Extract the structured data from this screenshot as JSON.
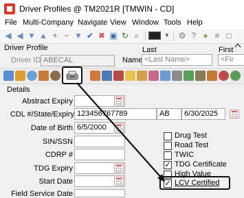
{
  "window": {
    "title": "Driver Profiles @ TM2021R [TMWIN - CD]"
  },
  "menu": [
    "File",
    "Multi-Company",
    "Navigate",
    "View",
    "Window",
    "Tools",
    "Help"
  ],
  "header": {
    "section_label": "Driver Profile",
    "driver_id_label": "Driver ID",
    "driver_id_value": "ABECAL",
    "name_label": "Name",
    "last_label": "Last",
    "last_placeholder": "<Last Name>",
    "first_label": "First",
    "first_placeholder": "<Fir"
  },
  "details": {
    "title": "Details",
    "abstract_expiry_label": "Abstract Expiry",
    "cdl_label": "CDL #/State/Expiry",
    "cdl_number": "123456767789",
    "cdl_state": "AB",
    "cdl_expiry": "6/30/2025",
    "dob_label": "Date of Birth",
    "dob_value": "6/5/2000",
    "sin_label": "SIN/SSN",
    "cdrp_label": "CDRP #",
    "tdg_expiry_label": "TDG Expiry",
    "start_date_label": "Start Date",
    "field_service_label": "Field Service Date"
  },
  "checkboxes": [
    {
      "label": "Drug Test",
      "checked": false
    },
    {
      "label": "Road Test",
      "checked": false
    },
    {
      "label": "TWIC",
      "checked": false
    },
    {
      "label": "TDG Certificate",
      "checked": true
    },
    {
      "label": "High Value",
      "checked": false
    },
    {
      "label": "LCV Certified",
      "checked": true
    }
  ],
  "icons": {
    "toolbar": [
      "back-arrow-icon",
      "forward-arrow-icon",
      "down-arrow-icon",
      "add-icon",
      "remove-icon",
      "checkmark-icon",
      "save-icon",
      "refresh-icon",
      "search-icon",
      "screen-icon",
      "tools-icon"
    ],
    "highlighted_strip_icon": "scanner-icon"
  },
  "colors": {
    "accent_red": "#d9534f",
    "annotation": "#111111"
  }
}
